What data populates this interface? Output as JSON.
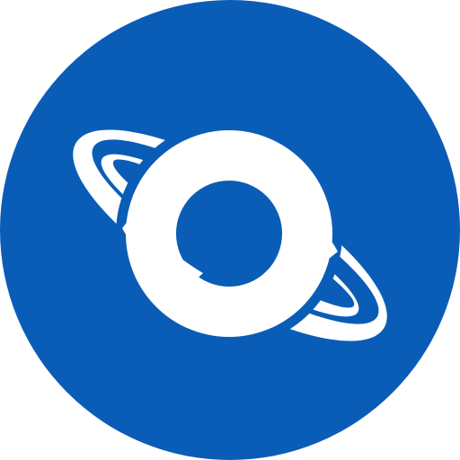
{
  "icon": {
    "name": "planet-ring-icon",
    "background_color": "#0A5DB7",
    "foreground_color": "#FFFFFF"
  }
}
